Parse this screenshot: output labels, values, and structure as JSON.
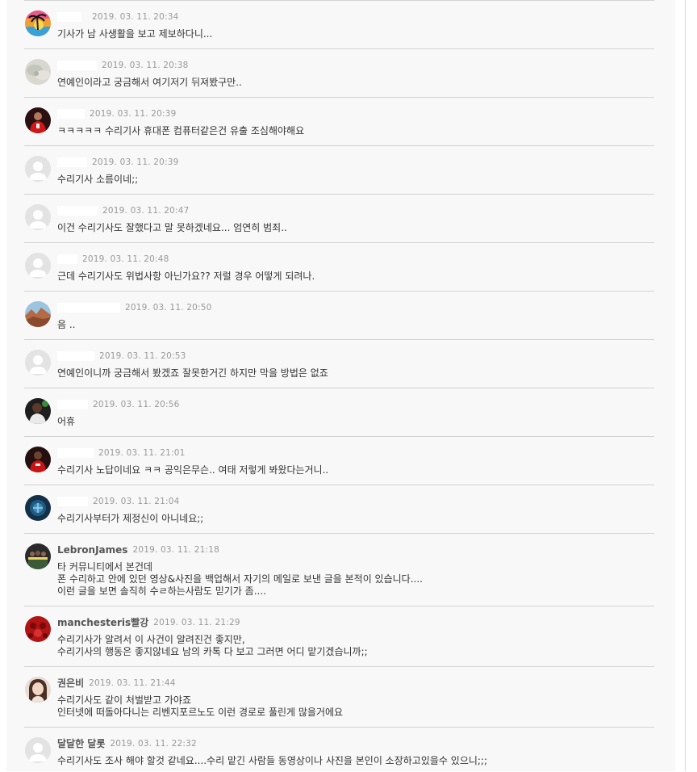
{
  "comments": [
    {
      "nick": "",
      "date": "2019. 03. 11.  20:34",
      "lines": [
        "기사가 남 사생활을 보고 제보하다니..."
      ],
      "avatar": "palm-tree-sunset"
    },
    {
      "nick": "",
      "date": "2019. 03. 11.  20:38",
      "lines": [
        "연예인이라고 궁금해서 여기저기 뒤져봤구만.."
      ],
      "avatar": "grey-blur-photo"
    },
    {
      "nick": "",
      "date": "2019. 03. 11.  20:39",
      "lines": [
        "ㅋㅋㅋㅋㅋ 수리기사 휴대폰 컴퓨터같은건 유출 조심해야해요"
      ],
      "avatar": "red-jersey-player"
    },
    {
      "nick": "",
      "date": "2019. 03. 11.  20:39",
      "lines": [
        "수리기사 소름이네;;"
      ],
      "avatar": "default-user"
    },
    {
      "nick": "",
      "date": "2019. 03. 11.  20:47",
      "lines": [
        "이건 수리기사도 잘했다고 말 못하겠네요... 엄연히 범죄.."
      ],
      "avatar": "default-user"
    },
    {
      "nick": "",
      "date": "2019. 03. 11.  20:48",
      "lines": [
        "근데 수리기사도 위법사항 아닌가요?? 저럴 경우 어떻게 되려나."
      ],
      "avatar": "default-user"
    },
    {
      "nick": "",
      "date": "2019. 03. 11.  20:50",
      "lines": [
        "음 .."
      ],
      "avatar": "canyon-landscape"
    },
    {
      "nick": "",
      "date": "2019. 03. 11.  20:53",
      "lines": [
        "연예인이니까 궁금해서 봤겠죠 잘못한거긴 하지만 막을 방법은 없죠"
      ],
      "avatar": "default-user"
    },
    {
      "nick": "",
      "date": "2019. 03. 11.  20:56",
      "lines": [
        "어휴"
      ],
      "avatar": "footballer-photo"
    },
    {
      "nick": "",
      "date": "2019. 03. 11.  21:01",
      "lines": [
        "수리기사 노답이네요 ㅋㅋ 공익은무슨.. 여태 저렇게 봐왔다는거니.."
      ],
      "avatar": "red-jersey-player"
    },
    {
      "nick": "",
      "date": "2019. 03. 11.  21:04",
      "lines": [
        "수리기사부터가 제정신이 아니네요;;"
      ],
      "avatar": "blue-team-crest"
    },
    {
      "nick": "LebronJames",
      "date": "2019. 03. 11.  21:18",
      "lines": [
        "타 커뮤니티에서 본건데",
        "폰 수리하고 안에 있던 영상&사진을 백업해서 자기의 메일로 보낸 글을 본적이 있습니다....",
        "이런 글을 보면 솔직히 수ㄹ하는사람도 믿기가 좀...."
      ],
      "avatar": "basketball-team-photo"
    },
    {
      "nick": "manchesteris빨강",
      "date": "2019. 03. 11.  21:29",
      "lines": [
        "수리기사가 알려서 이 사건이 알려진건 좋지만,",
        "수리기사의 행동은 좋지않네요 남의 카톡 다 보고 그러면 어디 맡기겠습니까;;"
      ],
      "avatar": "red-crest"
    },
    {
      "nick": "권은비",
      "date": "2019. 03. 11.  21:44",
      "lines": [
        "수리기사도 같이 처벌받고 가야죠",
        "인터넷에 떠돌아다니는 리벤지포르노도 이런 경로로 풀린게 많을거에요"
      ],
      "avatar": "woman-portrait"
    },
    {
      "nick": "달달한 달롯",
      "date": "2019. 03. 11.  22:32",
      "lines": [
        "수리기사도 조사 해야 할것 같네요....수리 맡긴 사람들 동영상이나 사진을 본인이 소장하고있을수 있으니;;;"
      ],
      "avatar": "default-user"
    }
  ]
}
